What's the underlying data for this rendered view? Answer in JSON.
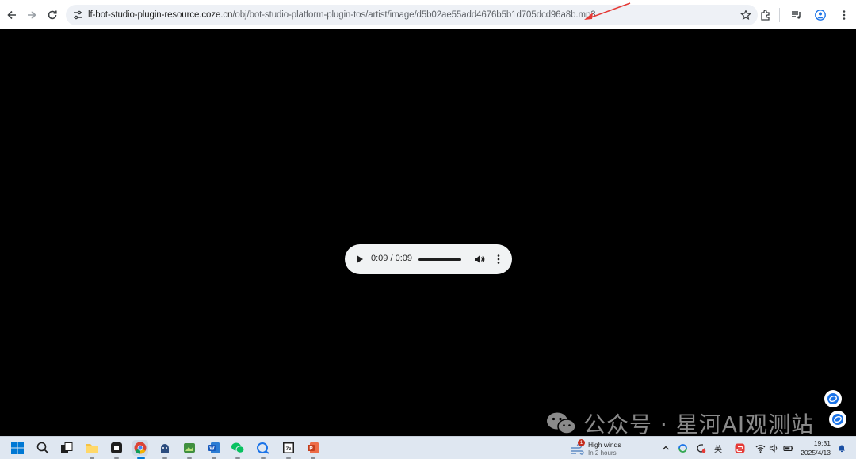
{
  "browser": {
    "url_host": "lf-bot-studio-plugin-resource.coze.cn",
    "url_path": "/obj/bot-studio-platform-plugin-tos/artist/image/d5b02ae55add4676b5b1d705dcd96a8b.mp3"
  },
  "audio": {
    "time": "0:09 / 0:09",
    "progress": 1.0
  },
  "watermark": {
    "text": "公众号 · 星河AI观测站"
  },
  "taskbar": {
    "weather_badge": "1",
    "weather_title": "High winds",
    "weather_sub": "In 2 hours",
    "ime": "英",
    "time": "19:31",
    "date": "2025/4/13"
  },
  "colors": {
    "page_bg": "#000000",
    "toolbar_bg": "#ffffff",
    "omnibox_bg": "#eef1f6",
    "audio_bg": "#f1f3f4",
    "arrow": "#e53935",
    "taskbar_bg": "#dfe7f1"
  },
  "icons": [
    "back-icon",
    "forward-icon",
    "reload-icon",
    "tune-icon",
    "bookmark-star-icon",
    "extensions-icon",
    "media-control-icon",
    "profile-icon",
    "menu-icon",
    "play-icon",
    "volume-icon",
    "more-icon"
  ]
}
